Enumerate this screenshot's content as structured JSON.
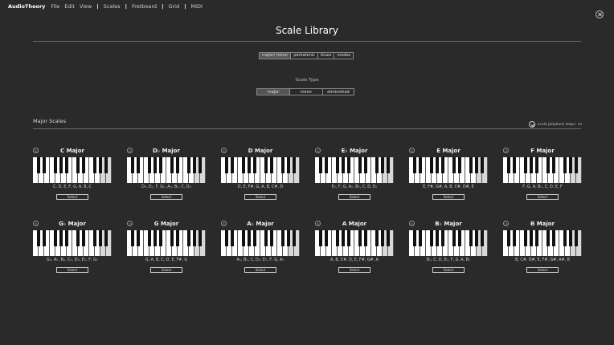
{
  "menubar": {
    "brand": "AudioTheory",
    "items": [
      "File",
      "Edit",
      "View",
      "Scales",
      "Fretboard",
      "Grid",
      "MIDI"
    ]
  },
  "page": {
    "title": "Scale Library"
  },
  "category_tabs": [
    {
      "label": "major/ minor",
      "active": true
    },
    {
      "label": "pentatonic",
      "active": false
    },
    {
      "label": "blues",
      "active": false
    },
    {
      "label": "modes",
      "active": false
    }
  ],
  "scale_type": {
    "label": "Scale Type",
    "options": [
      {
        "label": "major",
        "active": true
      },
      {
        "label": "minor",
        "active": false
      },
      {
        "label": "diminished",
        "active": false
      }
    ]
  },
  "section": {
    "title": "Major Scales",
    "playback_label": "scale playback loops: no"
  },
  "select_label": "Select",
  "scales": [
    {
      "name": "C Major",
      "notes": "C, D, E, F, G, A, B, C"
    },
    {
      "name": "D♭ Major",
      "notes": "D♭, E♭, F, G♭, A♭, B♭, C, D♭"
    },
    {
      "name": "D Major",
      "notes": "D, E, F#, G, A, B, C#, D"
    },
    {
      "name": "E♭ Major",
      "notes": "E♭, F, G, A♭, B♭, C, D, E♭"
    },
    {
      "name": "E Major",
      "notes": "E, F#, G#, A, B, C#, D#, E"
    },
    {
      "name": "F Major",
      "notes": "F, G, A, B♭, C, D, E, F"
    },
    {
      "name": "G♭ Major",
      "notes": "G♭, A♭, B♭, C♭, D♭, E♭, F, G♭"
    },
    {
      "name": "G Major",
      "notes": "G, A, B, C, D, E, F#, G"
    },
    {
      "name": "A♭ Major",
      "notes": "A♭, B♭, C, D♭, E♭, F, G, A♭"
    },
    {
      "name": "A Major",
      "notes": "A, B, C#, D, E, F#, G#, A"
    },
    {
      "name": "B♭ Major",
      "notes": "B♭, C, D, E♭, F, G, A, B♭"
    },
    {
      "name": "B Major",
      "notes": "B, C#, D#, E, F#, G#, A#, B"
    }
  ]
}
